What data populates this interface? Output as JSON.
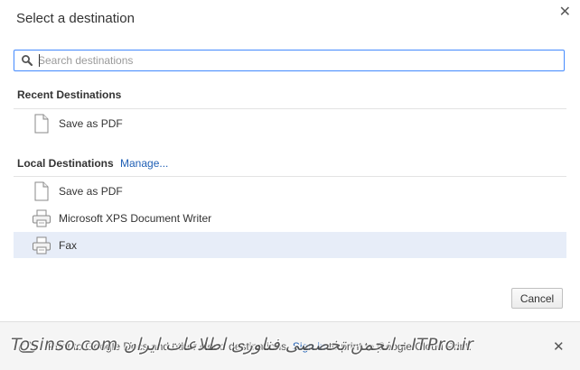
{
  "dialog": {
    "title": "Select a destination",
    "close_icon": "close-icon"
  },
  "search": {
    "placeholder": "Search destinations",
    "value": "",
    "icon": "search-icon"
  },
  "recent": {
    "header": "Recent Destinations",
    "items": [
      {
        "label": "Save as PDF",
        "icon": "document-icon"
      }
    ]
  },
  "local": {
    "header": "Local Destinations",
    "manage_label": "Manage...",
    "items": [
      {
        "label": "Save as PDF",
        "icon": "document-icon"
      },
      {
        "label": "Microsoft XPS Document Writer",
        "icon": "printer-icon"
      },
      {
        "label": "Fax",
        "icon": "printer-icon",
        "selected": true
      }
    ]
  },
  "buttons": {
    "cancel_label": "Cancel"
  },
  "footer": {
    "text_before": "Print to Google Docs and other cloud destinations.",
    "sign_in_label": "Sign in",
    "text_after": "to print to Google Cloud Print.",
    "icon": "cloud-icon",
    "close_icon": "close-icon"
  },
  "watermark": {
    "text": "Tosinso.com انجمن تخصصی فناوری اطلاعات ایران - ITPro.ir"
  },
  "colors": {
    "link": "#1f5fb5",
    "selected_row": "#e7edf8",
    "focus_border": "#4d90fe"
  }
}
